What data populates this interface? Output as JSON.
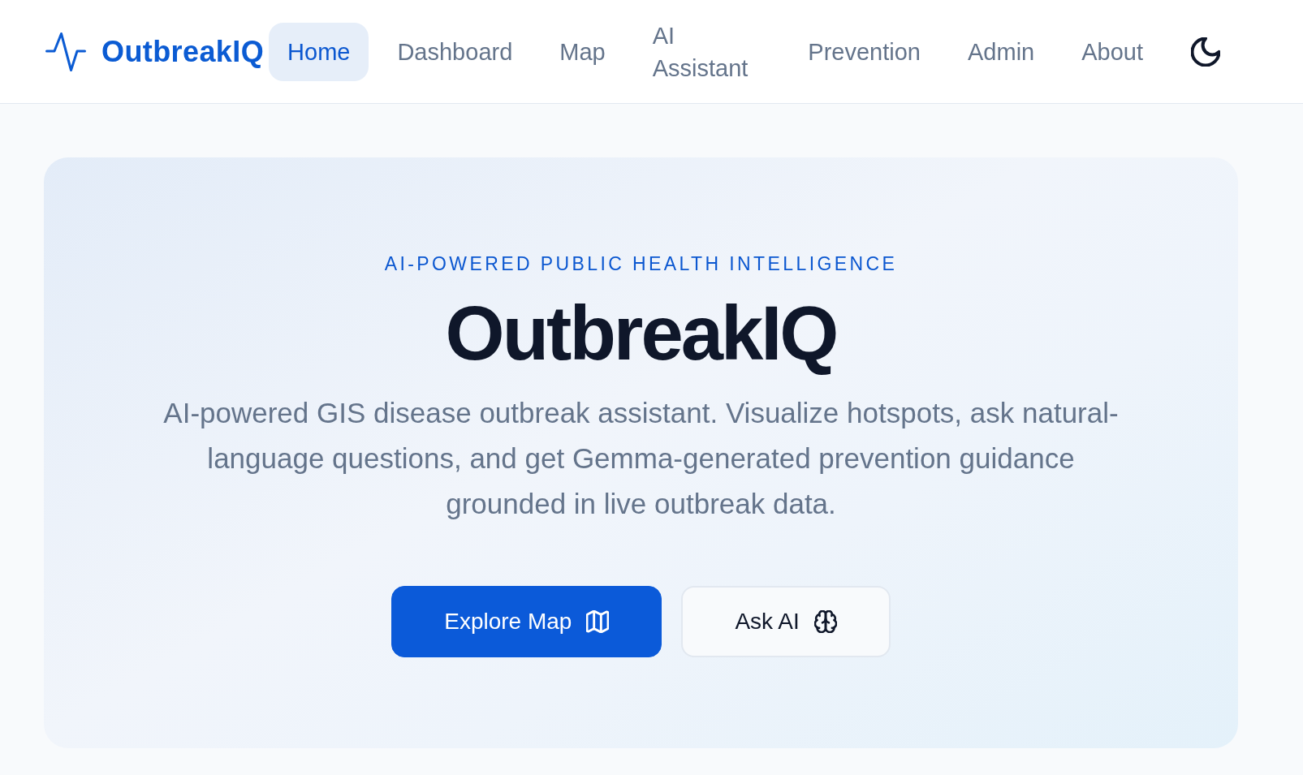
{
  "brand": {
    "name": "OutbreakIQ"
  },
  "nav": {
    "items": [
      {
        "label": "Home",
        "selected": true
      },
      {
        "label": "Dashboard",
        "selected": false
      },
      {
        "label": "Map",
        "selected": false
      },
      {
        "label": "AI Assistant",
        "selected": false
      },
      {
        "label": "Prevention",
        "selected": false
      },
      {
        "label": "Admin",
        "selected": false
      },
      {
        "label": "About",
        "selected": false
      }
    ]
  },
  "hero": {
    "eyebrow": "AI-POWERED PUBLIC HEALTH INTELLIGENCE",
    "title": "OutbreakIQ",
    "description": "AI-powered GIS disease outbreak assistant. Visualize hotspots, ask natural-language questions, and get Gemma-generated prevention guidance grounded in live outbreak data.",
    "actions": [
      {
        "label": "Explore Map",
        "kind": "primary"
      },
      {
        "label": "Ask AI",
        "kind": "secondary"
      }
    ]
  }
}
